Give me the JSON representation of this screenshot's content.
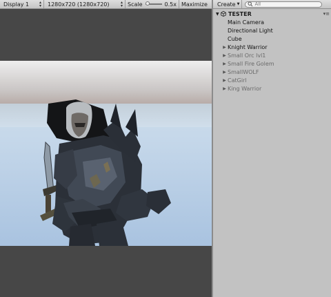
{
  "game_view": {
    "display": "Display 1",
    "resolution": "1280x720 (1280x720)",
    "scale_label": "Scale",
    "scale_value": "0.5x",
    "maximize": "Maximize"
  },
  "hierarchy": {
    "create": "Create",
    "search_placeholder": "All",
    "scene": "TESTER",
    "items": [
      {
        "label": "Main Camera",
        "arrow": ""
      },
      {
        "label": "Directional Light",
        "arrow": ""
      },
      {
        "label": "Cube",
        "arrow": ""
      },
      {
        "label": "Knight Warrior",
        "arrow": "▶"
      },
      {
        "label": "Small Orc lvl1",
        "arrow": "▶"
      },
      {
        "label": "Small Fire Golem",
        "arrow": "▶"
      },
      {
        "label": "SmallWOLF",
        "arrow": "▶"
      },
      {
        "label": "CatGirl",
        "arrow": "▶"
      },
      {
        "label": "King Warrior",
        "arrow": "▶"
      }
    ]
  },
  "icons": {
    "scene": "unity-logo-icon",
    "search": "search-icon",
    "menu": "panel-menu-icon",
    "fold": "triangle-right-icon"
  },
  "colors": {
    "panel_bg": "#c2c2c2",
    "game_bg": "#474747",
    "faded_text": "#6a6a6a"
  }
}
